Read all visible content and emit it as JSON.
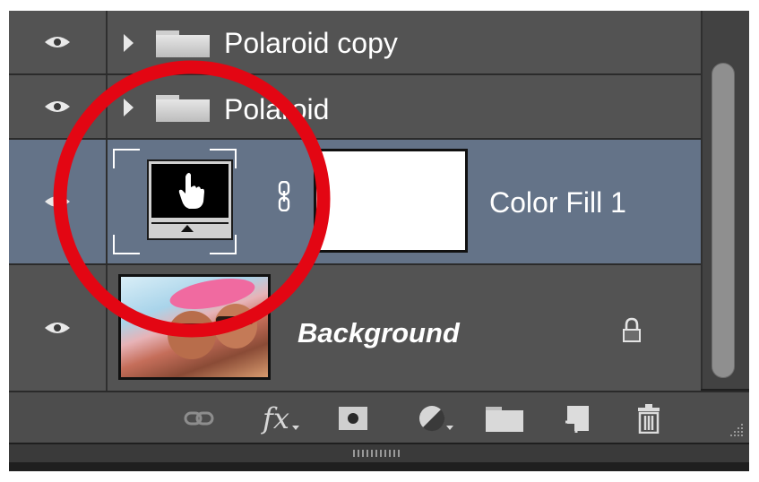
{
  "layers": [
    {
      "name": "Polaroid copy",
      "kind": "group",
      "visible": true
    },
    {
      "name": "Polaroid",
      "kind": "group",
      "visible": true
    },
    {
      "name": "Color Fill 1",
      "kind": "fill-adjustment",
      "visible": true,
      "selected": true,
      "mask_color": "#ffffff"
    },
    {
      "name": "Background",
      "kind": "pixel",
      "visible": true,
      "locked": true
    }
  ],
  "icons": {
    "visibility": "eye-icon",
    "expand": "triangle-right-icon",
    "group": "folder-icon",
    "link": "chain-link-icon",
    "lock": "lock-icon"
  },
  "toolbar": [
    "link-layers-icon",
    "fx-icon",
    "add-mask-icon",
    "adjustment-layer-icon",
    "new-group-icon",
    "new-layer-icon",
    "delete-icon"
  ],
  "toolbar_fx_label": "fx",
  "annotation": {
    "shape": "circle",
    "color": "#e30613"
  },
  "colors": {
    "panel_bg": "#535353",
    "selected_row": "#647388",
    "text": "#ffffff"
  }
}
